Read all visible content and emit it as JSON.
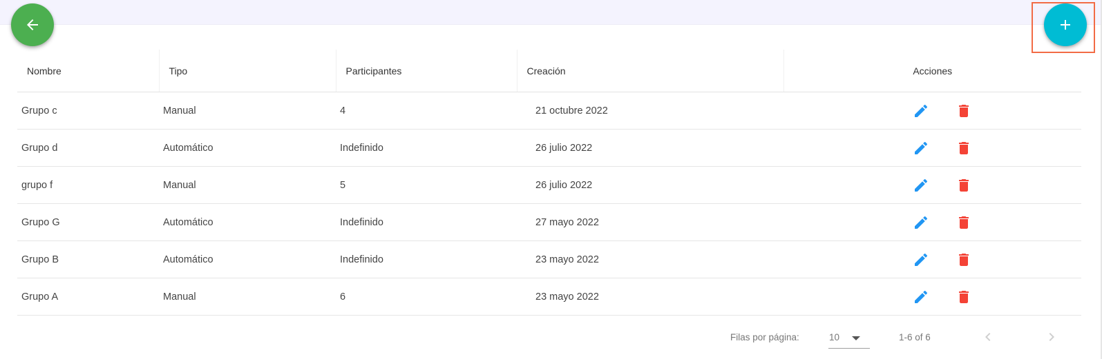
{
  "header_actions": {
    "back_icon": "arrow-left-icon",
    "add_icon": "plus-icon",
    "back_color": "#4caf50",
    "add_color": "#00bcd4",
    "highlight_color": "#f26b45"
  },
  "table": {
    "columns": [
      "Nombre",
      "Tipo",
      "Participantes",
      "Creación",
      "Acciones"
    ],
    "rows": [
      {
        "nombre": "Grupo c",
        "tipo": "Manual",
        "participantes": "4",
        "creacion": "21 octubre 2022"
      },
      {
        "nombre": "Grupo d",
        "tipo": "Automático",
        "participantes": "Indefinido",
        "creacion": "26 julio 2022"
      },
      {
        "nombre": "grupo f",
        "tipo": "Manual",
        "participantes": "5",
        "creacion": "26 julio 2022"
      },
      {
        "nombre": "Grupo G",
        "tipo": "Automático",
        "participantes": "Indefinido",
        "creacion": "27 mayo 2022"
      },
      {
        "nombre": "Grupo B",
        "tipo": "Automático",
        "participantes": "Indefinido",
        "creacion": "23 mayo 2022"
      },
      {
        "nombre": "Grupo A",
        "tipo": "Manual",
        "participantes": "6",
        "creacion": "23 mayo 2022"
      }
    ],
    "action_icons": {
      "edit": "pencil-icon",
      "delete": "trash-icon"
    },
    "edit_color": "#2196f3",
    "delete_color": "#f44336"
  },
  "pagination": {
    "rows_per_page_label": "Filas por página:",
    "rows_per_page_value": "10",
    "range": "1-6 of 6",
    "prev_icon": "chevron-left-icon",
    "next_icon": "chevron-right-icon"
  }
}
